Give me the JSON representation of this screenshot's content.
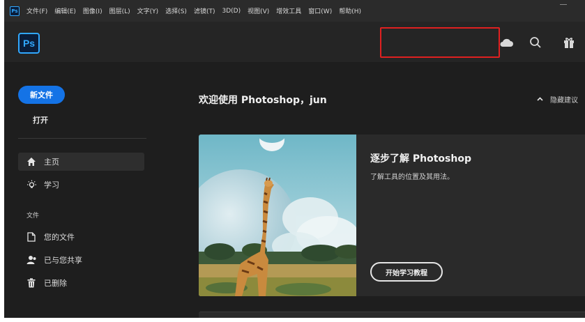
{
  "menubar": {
    "items": [
      "文件(F)",
      "编辑(E)",
      "图像(I)",
      "图层(L)",
      "文字(Y)",
      "选择(S)",
      "滤镜(T)",
      "3D(D)",
      "视图(V)",
      "增效工具",
      "窗口(W)",
      "帮助(H)"
    ]
  },
  "header": {
    "logo": "Ps",
    "icons": [
      "cloud-icon",
      "search-icon",
      "gift-icon"
    ]
  },
  "sidebar": {
    "new_label": "新文件",
    "open_label": "打开",
    "nav": [
      {
        "label": "主页",
        "icon": "home-icon",
        "active": true
      },
      {
        "label": "学习",
        "icon": "lightbulb-icon",
        "active": false
      }
    ],
    "files_section": "文件",
    "file_items": [
      {
        "label": "您的文件",
        "icon": "document-icon"
      },
      {
        "label": "已与您共享",
        "icon": "shared-user-icon"
      },
      {
        "label": "已删除",
        "icon": "trash-icon"
      }
    ]
  },
  "main": {
    "welcome": "欢迎使用 Photoshop，jun",
    "hide_recommendations": "隐藏建议",
    "card": {
      "title": "逐步了解 Photoshop",
      "description": "了解工具的位置及其用法。",
      "button": "开始学习教程"
    }
  },
  "colors": {
    "accent": "#1473e6",
    "ps_blue": "#31a8ff",
    "highlight": "#e02020"
  }
}
